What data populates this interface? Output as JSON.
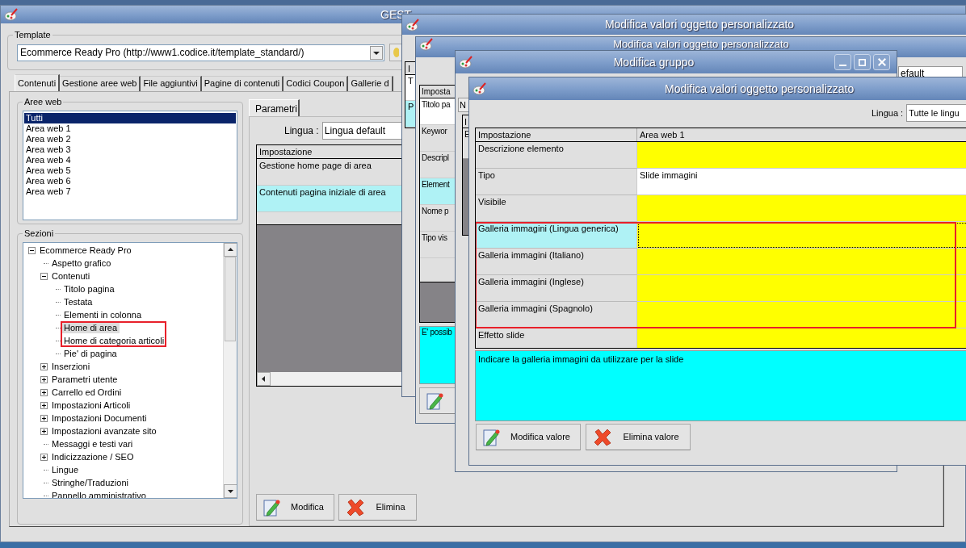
{
  "main_window": {
    "title": "GEST",
    "template": {
      "label": "Template",
      "value": "Ecommerce Ready Pro (http://www1.codice.it/template_standard/)"
    },
    "tabs": [
      {
        "label": "Contenuti",
        "selected": true
      },
      {
        "label": "Gestione aree web",
        "selected": false
      },
      {
        "label": "File aggiuntivi",
        "selected": false
      },
      {
        "label": "Pagine di contenuti",
        "selected": false
      },
      {
        "label": "Codici Coupon",
        "selected": false
      },
      {
        "label": "Gallerie d",
        "selected": false
      }
    ],
    "aree_web": {
      "label": "Aree web",
      "items": [
        {
          "label": "Tutti",
          "selected": true
        },
        {
          "label": "Area web 1",
          "selected": false
        },
        {
          "label": "Area web 2",
          "selected": false
        },
        {
          "label": "Area web 3",
          "selected": false
        },
        {
          "label": "Area web 4",
          "selected": false
        },
        {
          "label": "Area web 5",
          "selected": false
        },
        {
          "label": "Area web 6",
          "selected": false
        },
        {
          "label": "Area web 7",
          "selected": false
        }
      ]
    },
    "sezioni": {
      "label": "Sezioni",
      "tree": [
        {
          "label": "Ecommerce Ready Pro",
          "expanded": true,
          "selected": false,
          "children": [
            {
              "label": "Aspetto grafico",
              "selected": false
            },
            {
              "label": "Contenuti",
              "expanded": true,
              "selected": false,
              "children": [
                {
                  "label": "Titolo pagina",
                  "selected": false,
                  "annotated": false
                },
                {
                  "label": "Testata",
                  "selected": false,
                  "annotated": false
                },
                {
                  "label": "Elementi in colonna",
                  "selected": false,
                  "annotated": false
                },
                {
                  "label": "Home di area",
                  "selected": true,
                  "annotated": true
                },
                {
                  "label": "Home di categoria articoli",
                  "selected": false,
                  "annotated": true
                },
                {
                  "label": "Pie' di pagina",
                  "selected": false,
                  "annotated": false
                }
              ]
            },
            {
              "label": "Inserzioni",
              "expanded": false,
              "selected": false
            },
            {
              "label": "Parametri utente",
              "expanded": false,
              "selected": false
            },
            {
              "label": "Carrello ed Ordini",
              "expanded": false,
              "selected": false
            },
            {
              "label": "Impostazioni Articoli",
              "expanded": false,
              "selected": false
            },
            {
              "label": "Impostazioni Documenti",
              "expanded": false,
              "selected": false
            },
            {
              "label": "Impostazioni avanzate sito",
              "expanded": false,
              "selected": false
            },
            {
              "label": "Messaggi e testi vari",
              "selected": false
            },
            {
              "label": "Indicizzazione / SEO",
              "expanded": false,
              "selected": false
            },
            {
              "label": "Lingue",
              "selected": false
            },
            {
              "label": "Stringhe/Traduzioni",
              "selected": false
            },
            {
              "label": "Pannello amministrativo",
              "selected": false
            }
          ]
        }
      ]
    },
    "parametri": {
      "tab": {
        "label": "Parametri",
        "selected": true
      },
      "lingua_label": "Lingua :",
      "lingua_value": "Lingua default",
      "column": "Impostazione",
      "rows": [
        {
          "label": "Gestione home page di area",
          "selected": false
        },
        {
          "label": "Contenuti pagina iniziale di area",
          "selected": true
        }
      ],
      "buttons": [
        {
          "label": "Modifica",
          "kind": "edit"
        },
        {
          "label": "Elimina",
          "kind": "delete"
        }
      ]
    }
  },
  "window_2": {
    "title": "Modifica valori oggetto personalizzato",
    "column": "I",
    "rows": [
      {
        "label": "T",
        "selected": false
      },
      {
        "label": "P",
        "selected": true
      }
    ]
  },
  "window_3": {
    "title": "Modifica valori oggetto personalizzato",
    "lingua_value": "efault",
    "column": "Imposta",
    "rows": [
      {
        "label": "Titolo pa",
        "selected": false
      },
      {
        "label": "Keywor",
        "selected": false
      },
      {
        "label": "Descripl",
        "selected": false
      },
      {
        "label": "Element",
        "selected": true
      },
      {
        "label": "Nome p",
        "selected": false
      },
      {
        "label": "Tipo vis",
        "selected": false
      }
    ],
    "description": "E' possib",
    "buttons": [
      {
        "kind": "edit"
      }
    ]
  },
  "window_4": {
    "title": "Modifica gruppo",
    "field": "N",
    "column": "I",
    "rows": [
      {
        "label": "E",
        "selected": false
      }
    ]
  },
  "window_5": {
    "title": "Modifica valori oggetto personalizzato",
    "lingua_label": "Lingua :",
    "lingua_value": "Tutte le lingu",
    "columns": [
      "Impostazione",
      "Area web 1"
    ],
    "rows": [
      {
        "label": "Descrizione elemento",
        "value": "",
        "color": "#ffff00",
        "selected": false,
        "annotated": false
      },
      {
        "label": "Tipo",
        "value": "Slide immagini",
        "color": "#ffffff",
        "selected": false,
        "annotated": false
      },
      {
        "label": "Visibile",
        "color": "#ffff00",
        "selected": false,
        "annotated": false
      },
      {
        "label": "Galleria immagini (Lingua generica)",
        "color": "#ffff00",
        "selected": true,
        "annotated": true
      },
      {
        "label": "Galleria immagini (Italiano)",
        "color": "#ffff00",
        "selected": false,
        "annotated": true
      },
      {
        "label": "Galleria immagini (Inglese)",
        "color": "#ffff00",
        "selected": false,
        "annotated": true
      },
      {
        "label": "Galleria immagini (Spagnolo)",
        "color": "#ffff00",
        "selected": false,
        "annotated": true
      },
      {
        "label": "Effetto slide",
        "color": "#ffff00",
        "selected": false,
        "annotated": false
      }
    ],
    "description": "Indicare la galleria immagini da utilizzare per la slide",
    "buttons": [
      {
        "label": "Modifica valore",
        "kind": "edit"
      },
      {
        "label": "Elimina valore",
        "kind": "delete"
      }
    ]
  }
}
